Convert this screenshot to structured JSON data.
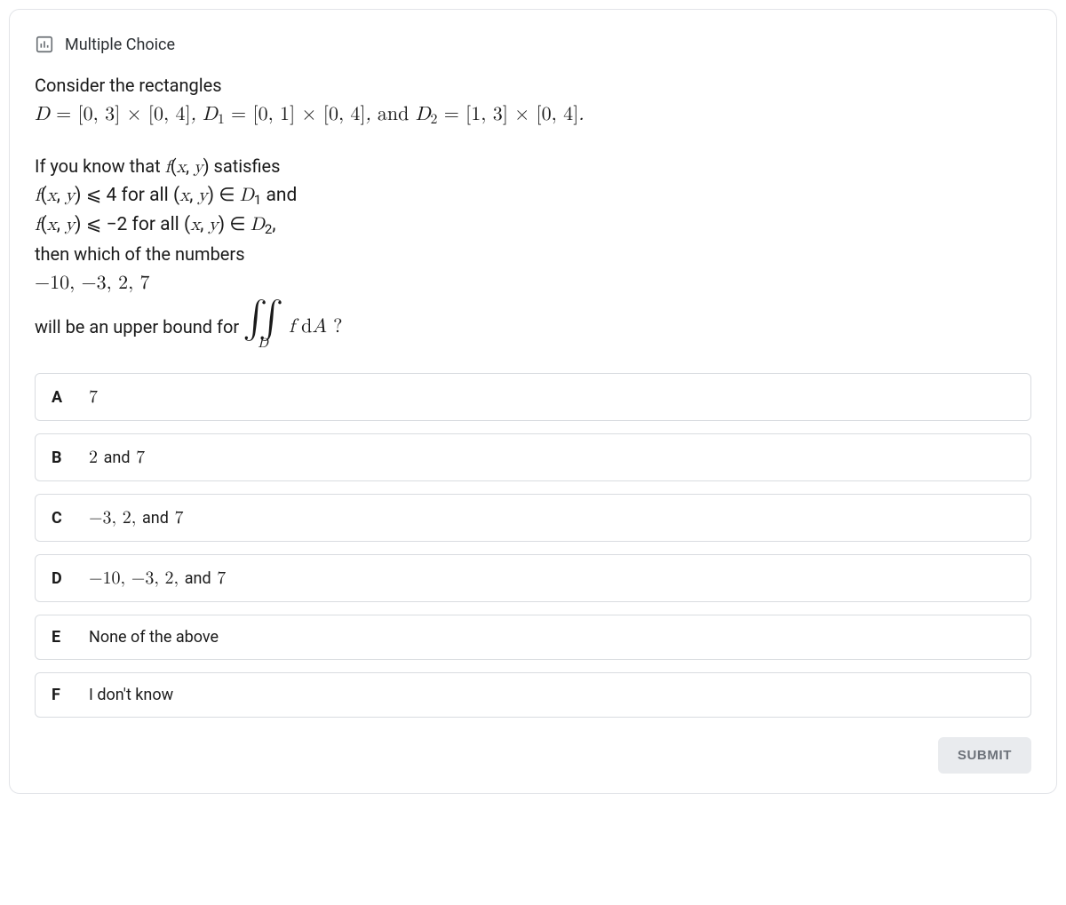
{
  "header": {
    "title": "Multiple Choice",
    "icon_name": "poll-icon"
  },
  "question": {
    "intro": "Consider the rectangles",
    "rect_defs_html": "<span class='math'>D</span> <span class='mathup'>= [0, 3] × [0, 4]</span>, <span class='math'>D</span><span class='sub'>1</span> <span class='mathup'>= [0, 1] × [0, 4]</span>, <span style='font-family:inherit;font-style:normal'>and</span> <span class='math'>D</span><span class='sub'>2</span> <span class='mathup'>= [1, 3] × [0, 4]</span>.",
    "cond_lead": "If you know that <span class='math'>f</span>(<span class='math'>x</span>, <span class='math'>y</span>) satisfies",
    "cond1_html": "<span class='math'>f</span>(<span class='math'>x</span>, <span class='math'>y</span>) <span class='mathup'>⩽ 4</span> for all (<span class='math'>x</span>, <span class='math'>y</span>) <span class='mathup'>∈</span> <span class='math'>D</span><span class='sub'>1</span> and",
    "cond2_html": "<span class='math'>f</span>(<span class='math'>x</span>, <span class='math'>y</span>) <span class='mathup'>⩽ −2</span> for all (<span class='math'>x</span>, <span class='math'>y</span>) <span class='mathup'>∈</span> <span class='math'>D</span><span class='sub'>2</span>,",
    "then_line": "then which of the numbers",
    "candidates": "−10, −3, 2, 7",
    "final_lead": "will be an upper bound for",
    "integral_symbols": "∫∫",
    "integral_domain": "D",
    "integrand_html": "<span class='math'>f</span> <span class='mathup'>d</span><span class='math'>A</span> <span class='mathup'>?</span>"
  },
  "options": [
    {
      "letter": "A",
      "text_html": "7",
      "plain": false
    },
    {
      "letter": "B",
      "text_html": "2 <span style='font-family:-apple-system,BlinkMacSystemFont,Segoe UI,Roboto,sans-serif;font-size:18px'>and</span> 7",
      "plain": false
    },
    {
      "letter": "C",
      "text_html": "−3, 2, <span style='font-family:-apple-system,BlinkMacSystemFont,Segoe UI,Roboto,sans-serif;font-size:18px'>and</span> 7",
      "plain": false
    },
    {
      "letter": "D",
      "text_html": "−10, −3, 2, <span style='font-family:-apple-system,BlinkMacSystemFont,Segoe UI,Roboto,sans-serif;font-size:18px'>and</span> 7",
      "plain": false
    },
    {
      "letter": "E",
      "text_html": "None of the above",
      "plain": true
    },
    {
      "letter": "F",
      "text_html": "I don't know",
      "plain": true
    }
  ],
  "footer": {
    "submit_label": "SUBMIT"
  }
}
